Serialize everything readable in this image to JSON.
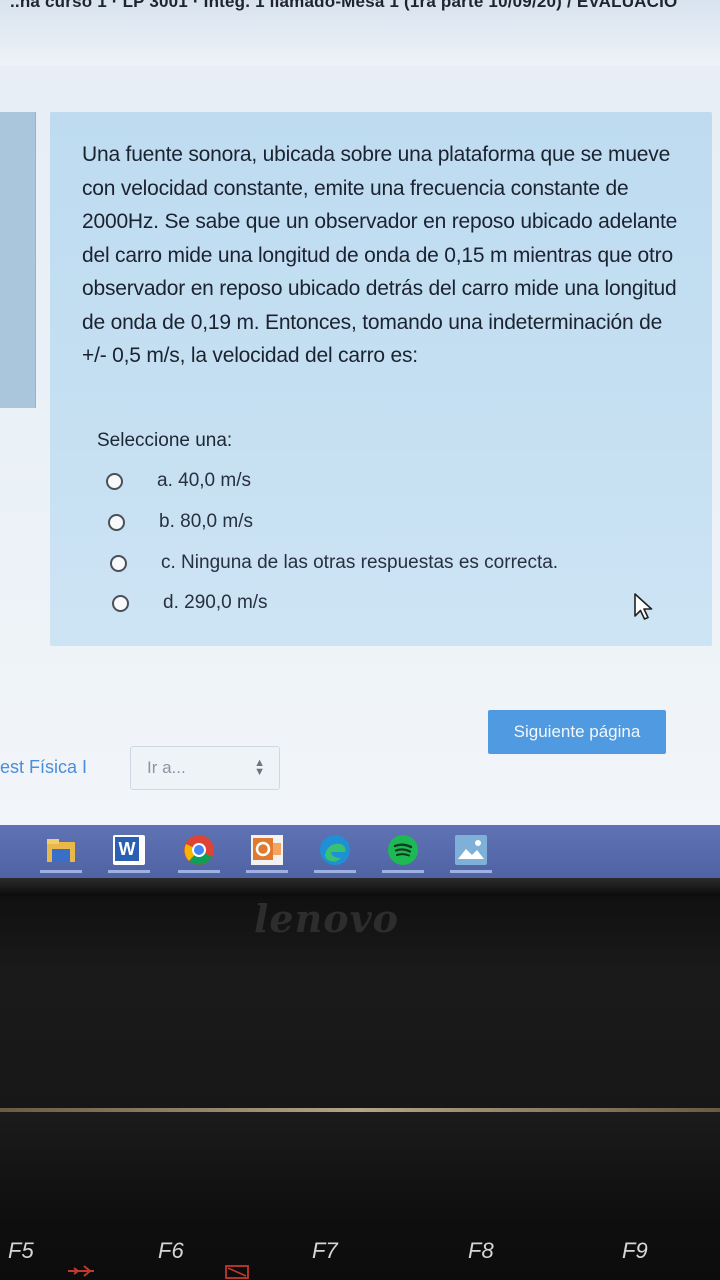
{
  "header": {
    "breadcrumb": "..na curso 1 · LP 3001 · Integ. 1 llamado-Mesa 1 (1ra parte 10/09/20) / EVALUACIO"
  },
  "question": {
    "text": "Una fuente sonora, ubicada sobre una plataforma que se mueve con velocidad constante, emite una frecuencia constante de 2000Hz. Se sabe que un observador en reposo ubicado adelante del carro mide una longitud de onda de 0,15 m mientras que otro observador en reposo ubicado detrás del carro mide una longitud de onda de 0,19 m. Entonces, tomando una indeterminación de +/- 0,5 m/s, la velocidad del carro es:",
    "select_prompt": "Seleccione una:",
    "options": [
      {
        "label": "a. 40,0 m/s"
      },
      {
        "label": "b. 80,0 m/s"
      },
      {
        "label": "c. Ninguna de las otras respuestas es correcta."
      },
      {
        "label": "d. 290,0 m/s"
      }
    ]
  },
  "navigation": {
    "next_label": "Siguiente página",
    "prev_link": "est Física I",
    "goto_label": "Ir a..."
  },
  "taskbar": {
    "apps": [
      {
        "name": "file-explorer",
        "icon": "folder-icon"
      },
      {
        "name": "word",
        "icon": "word-icon",
        "letter": "W"
      },
      {
        "name": "chrome",
        "icon": "chrome-icon"
      },
      {
        "name": "outlook",
        "icon": "outlook-icon",
        "letter": "O"
      },
      {
        "name": "edge",
        "icon": "edge-icon"
      },
      {
        "name": "spotify",
        "icon": "spotify-icon"
      },
      {
        "name": "photos",
        "icon": "photos-icon"
      }
    ]
  },
  "device": {
    "brand": "lenovo",
    "keys": [
      "F5",
      "F6",
      "F7",
      "F8",
      "F9"
    ]
  },
  "colors": {
    "question_bg": "#c4def2",
    "button": "#4f9ae0",
    "taskbar": "#586bad",
    "link": "#4a8ed8"
  }
}
